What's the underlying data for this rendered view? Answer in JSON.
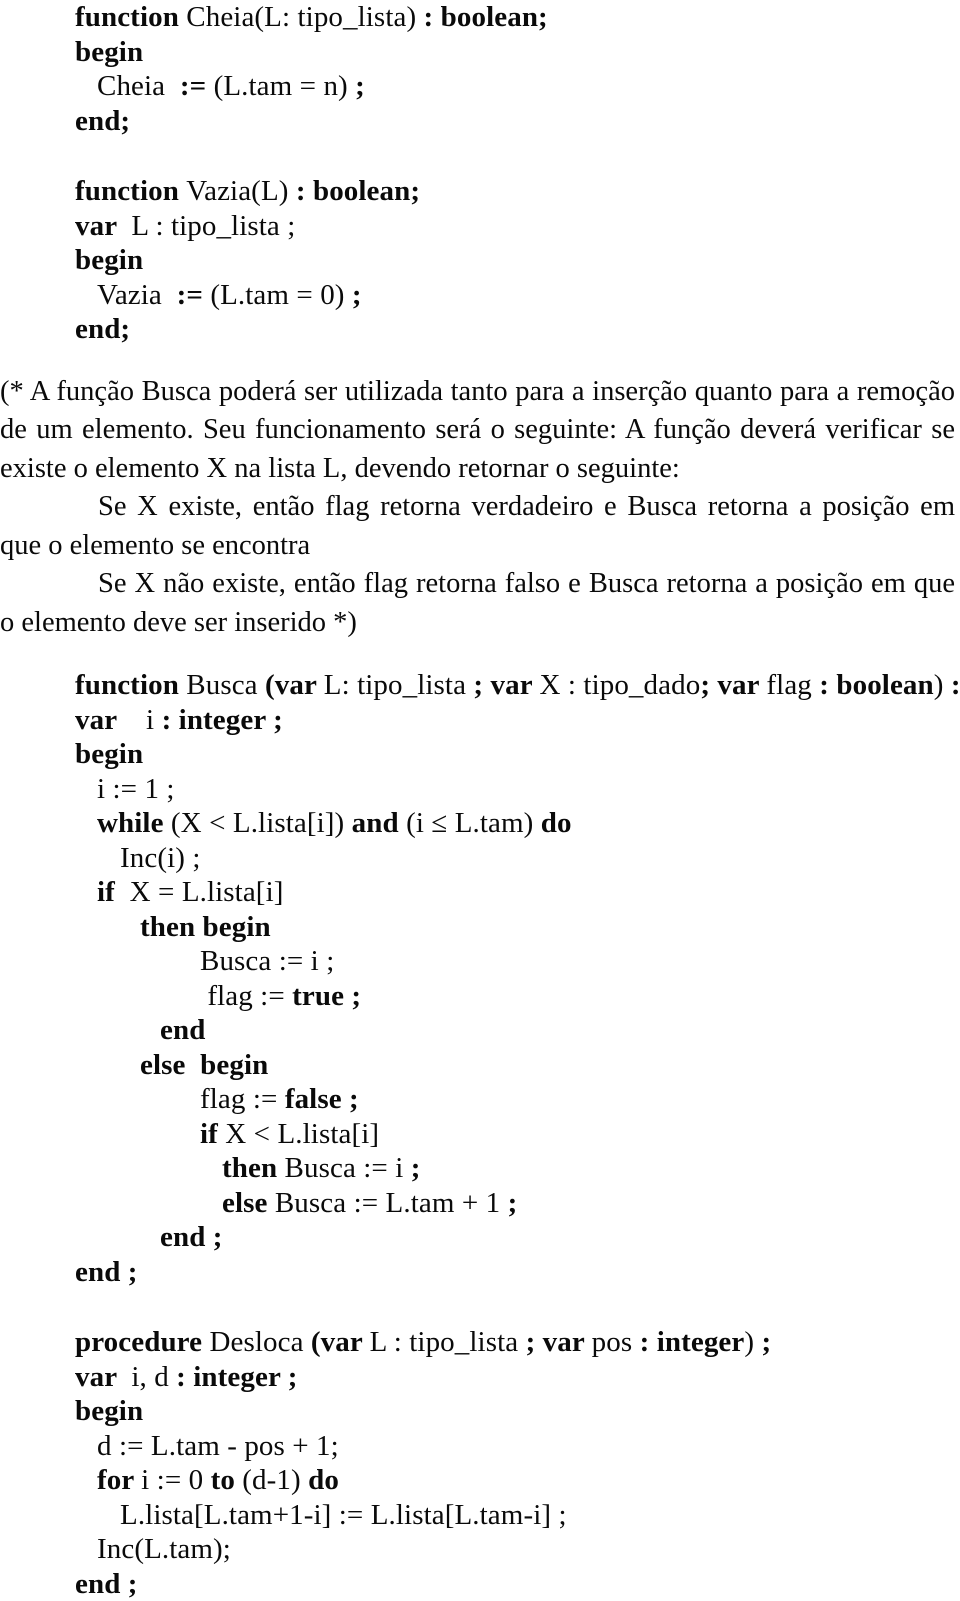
{
  "document": {
    "language": "pt-BR",
    "kind": "pascal-source-listing"
  },
  "blocks": [
    {
      "id": "cheia",
      "type": "code",
      "name": "function-cheia",
      "lines": [
        {
          "indent": 0,
          "spans": [
            {
              "t": "function ",
              "w": "bold"
            },
            {
              "t": "Cheia(L: tipo_lista)",
              "w": "normal"
            },
            {
              "t": " : boolean;",
              "w": "bold"
            }
          ]
        },
        {
          "indent": 0,
          "spans": [
            {
              "t": "begin",
              "w": "bold"
            }
          ]
        },
        {
          "indent": 1,
          "spans": [
            {
              "t": "Cheia  ",
              "w": "normal"
            },
            {
              "t": ":=",
              "w": "bold"
            },
            {
              "t": " (L.tam = n) ",
              "w": "normal"
            },
            {
              "t": ";",
              "w": "bold"
            }
          ]
        },
        {
          "indent": 0,
          "spans": [
            {
              "t": "end;",
              "w": "bold"
            }
          ]
        }
      ]
    },
    {
      "id": "vazia",
      "type": "code",
      "name": "function-vazia",
      "lines": [
        {
          "indent": 0,
          "spans": [
            {
              "t": "function ",
              "w": "bold"
            },
            {
              "t": "Vazia(L)",
              "w": "normal"
            },
            {
              "t": " : boolean;",
              "w": "bold"
            }
          ]
        },
        {
          "indent": 0,
          "spans": [
            {
              "t": "var ",
              "w": "bold"
            },
            {
              "t": " L : tipo_lista ;",
              "w": "normal"
            }
          ]
        },
        {
          "indent": 0,
          "spans": [
            {
              "t": "begin",
              "w": "bold"
            }
          ]
        },
        {
          "indent": 1,
          "spans": [
            {
              "t": "Vazia  ",
              "w": "normal"
            },
            {
              "t": ":=",
              "w": "bold"
            },
            {
              "t": " (L.tam = 0) ",
              "w": "normal"
            },
            {
              "t": ";",
              "w": "bold"
            }
          ]
        },
        {
          "indent": 0,
          "spans": [
            {
              "t": "end;",
              "w": "bold"
            }
          ]
        }
      ]
    },
    {
      "id": "comment",
      "type": "prose",
      "name": "busca-comment-paragraph",
      "paragraphs": [
        {
          "indent": false,
          "text": "(* A função Busca poderá ser utilizada tanto para a inserção quanto para a remoção de um elemento. Seu funcionamento será o seguinte: A função deverá verificar se existe o elemento X na lista L, devendo retornar o seguinte:"
        },
        {
          "indent": true,
          "text": "Se X existe, então flag retorna verdadeiro e Busca retorna a posição em que o elemento se encontra"
        },
        {
          "indent": true,
          "text": "Se X não existe, então flag retorna falso e Busca  retorna a posição em que o elemento deve ser inserido *)"
        }
      ]
    },
    {
      "id": "busca",
      "type": "code",
      "name": "function-busca",
      "lines": [
        {
          "indent": 0,
          "spans": [
            {
              "t": "function ",
              "w": "bold"
            },
            {
              "t": "Busca ",
              "w": "normal"
            },
            {
              "t": "(var ",
              "w": "bold"
            },
            {
              "t": "L: tipo_lista ",
              "w": "normal"
            },
            {
              "t": "; var ",
              "w": "bold"
            },
            {
              "t": "X : tipo_dado",
              "w": "normal"
            },
            {
              "t": "; var ",
              "w": "bold"
            },
            {
              "t": "flag ",
              "w": "normal"
            },
            {
              "t": ": boolean",
              "w": "bold"
            },
            {
              "t": ")",
              "w": "normal"
            },
            {
              "t": " :",
              "w": "bold"
            }
          ]
        },
        {
          "indent": 0,
          "spans": [
            {
              "t": "var ",
              "w": "bold"
            },
            {
              "t": "   i ",
              "w": "normal"
            },
            {
              "t": ": integer ;",
              "w": "bold"
            }
          ]
        },
        {
          "indent": 0,
          "spans": [
            {
              "t": "begin",
              "w": "bold"
            }
          ]
        },
        {
          "indent": 1,
          "spans": [
            {
              "t": "i := 1 ;",
              "w": "normal"
            }
          ]
        },
        {
          "indent": 1,
          "spans": [
            {
              "t": "while ",
              "w": "bold"
            },
            {
              "t": "(X < L.lista[i]) ",
              "w": "normal"
            },
            {
              "t": "and ",
              "w": "bold"
            },
            {
              "t": "(i ≤ L.tam) ",
              "w": "normal"
            },
            {
              "t": "do",
              "w": "bold"
            }
          ]
        },
        {
          "indent": 2,
          "spans": [
            {
              "t": "Inc(i) ;",
              "w": "normal"
            }
          ]
        },
        {
          "indent": 1,
          "spans": [
            {
              "t": "if ",
              "w": "bold"
            },
            {
              "t": " X = L.lista[i]",
              "w": "normal"
            }
          ]
        },
        {
          "indent": 3,
          "spans": [
            {
              "t": "then begin",
              "w": "bold"
            }
          ]
        },
        {
          "indent": 5,
          "spans": [
            {
              "t": "Busca := i ;",
              "w": "normal"
            }
          ]
        },
        {
          "indent": 5,
          "spans": [
            {
              "t": " flag := ",
              "w": "normal"
            },
            {
              "t": "true ;",
              "w": "bold"
            }
          ]
        },
        {
          "indent": 4,
          "spans": [
            {
              "t": "end",
              "w": "bold"
            }
          ]
        },
        {
          "indent": 3,
          "spans": [
            {
              "t": "else  begin",
              "w": "bold"
            }
          ]
        },
        {
          "indent": 5,
          "spans": [
            {
              "t": "flag := ",
              "w": "normal"
            },
            {
              "t": "false ;",
              "w": "bold"
            }
          ]
        },
        {
          "indent": 5,
          "spans": [
            {
              "t": "if ",
              "w": "bold"
            },
            {
              "t": "X < L.lista[i]",
              "w": "normal"
            }
          ]
        },
        {
          "indent": 6,
          "spans": [
            {
              "t": "then ",
              "w": "bold"
            },
            {
              "t": "Busca := i ",
              "w": "normal"
            },
            {
              "t": ";",
              "w": "bold"
            }
          ]
        },
        {
          "indent": 6,
          "spans": [
            {
              "t": "else ",
              "w": "bold"
            },
            {
              "t": "Busca := L.tam + 1 ",
              "w": "normal"
            },
            {
              "t": ";",
              "w": "bold"
            }
          ]
        },
        {
          "indent": 4,
          "spans": [
            {
              "t": "end ;",
              "w": "bold"
            }
          ]
        },
        {
          "indent": 0,
          "spans": [
            {
              "t": "end ;",
              "w": "bold"
            }
          ]
        }
      ]
    },
    {
      "id": "desloca",
      "type": "code",
      "name": "procedure-desloca",
      "lines": [
        {
          "indent": 0,
          "spans": [
            {
              "t": "procedure ",
              "w": "bold"
            },
            {
              "t": "Desloca ",
              "w": "normal"
            },
            {
              "t": "(var ",
              "w": "bold"
            },
            {
              "t": "L : tipo_lista ",
              "w": "normal"
            },
            {
              "t": "; var ",
              "w": "bold"
            },
            {
              "t": "pos ",
              "w": "normal"
            },
            {
              "t": ": integer",
              "w": "bold"
            },
            {
              "t": ")",
              "w": "normal"
            },
            {
              "t": " ;",
              "w": "bold"
            }
          ]
        },
        {
          "indent": 0,
          "spans": [
            {
              "t": "var ",
              "w": "bold"
            },
            {
              "t": " i, d ",
              "w": "normal"
            },
            {
              "t": ": integer ;",
              "w": "bold"
            }
          ]
        },
        {
          "indent": 0,
          "spans": [
            {
              "t": "begin",
              "w": "bold"
            }
          ]
        },
        {
          "indent": 1,
          "spans": [
            {
              "t": "d := L.tam - pos + 1;",
              "w": "normal"
            }
          ]
        },
        {
          "indent": 1,
          "spans": [
            {
              "t": "for ",
              "w": "bold"
            },
            {
              "t": "i := 0 ",
              "w": "normal"
            },
            {
              "t": "to ",
              "w": "bold"
            },
            {
              "t": "(d-1) ",
              "w": "normal"
            },
            {
              "t": "do",
              "w": "bold"
            }
          ]
        },
        {
          "indent": 2,
          "spans": [
            {
              "t": "L.lista[L.tam+1-i] := L.lista[L.tam-i] ;",
              "w": "normal"
            }
          ]
        },
        {
          "indent": 1,
          "spans": [
            {
              "t": "Inc(L.tam);",
              "w": "normal"
            }
          ]
        },
        {
          "indent": 0,
          "spans": [
            {
              "t": "end ;",
              "w": "bold"
            }
          ]
        }
      ]
    }
  ]
}
